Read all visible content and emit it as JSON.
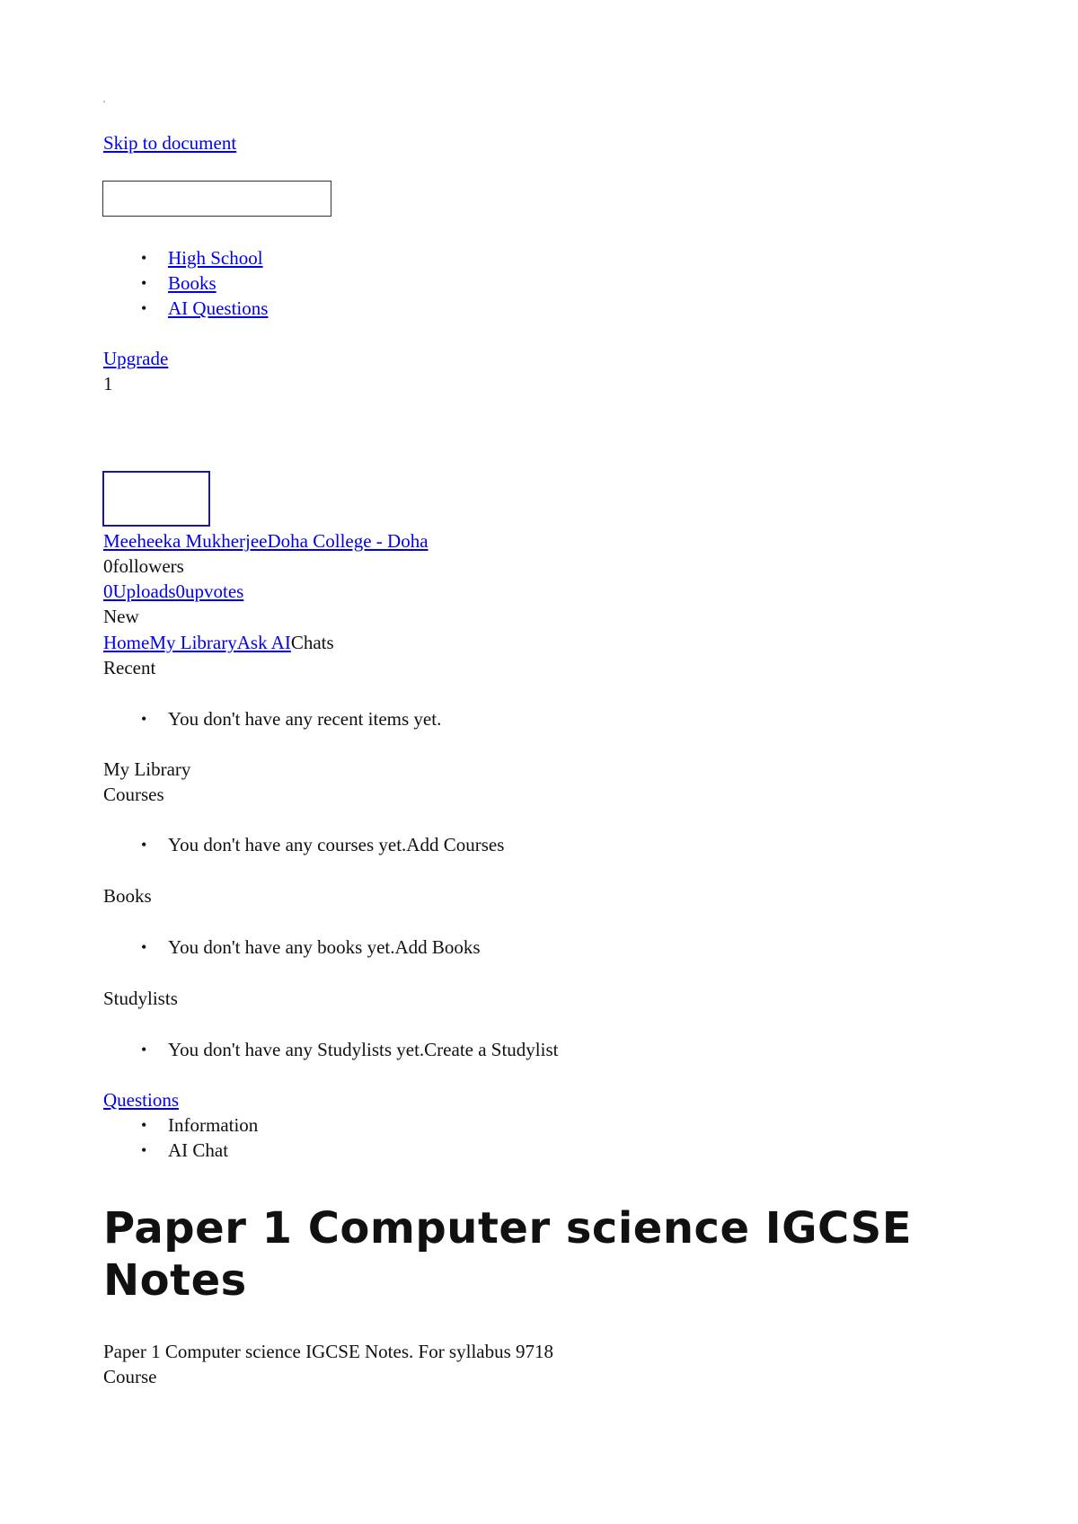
{
  "skip_link": "Skip to document",
  "search": {
    "placeholder": ""
  },
  "nav": {
    "items": [
      "High School",
      "Books",
      "AI Questions"
    ]
  },
  "upgrade": {
    "label": "Upgrade",
    "count": "1"
  },
  "profile": {
    "name_link": "Meeheeka MukherjeeDoha College - Doha",
    "followers": "0followers",
    "stats_link": "0Uploads0upvotes"
  },
  "new_label": "New",
  "menu": {
    "home": "Home",
    "library": "My Library",
    "ask_ai": "Ask AI",
    "chats": "Chats"
  },
  "recent": {
    "heading": "Recent",
    "empty": "You don't have any recent items yet."
  },
  "library": {
    "heading": "My Library",
    "courses_heading": "Courses",
    "courses_empty": "You don't have any courses yet.",
    "courses_action": "Add Courses",
    "books_heading": "Books",
    "books_empty": "You don't have any books yet.",
    "books_action": "Add Books",
    "studylists_heading": "Studylists",
    "studylists_empty": "You don't have any Studylists yet.",
    "studylists_action": "Create a Studylist"
  },
  "questions_link": "Questions",
  "doc_tabs": [
    "Information",
    "AI Chat"
  ],
  "document": {
    "title": "Paper 1 Computer science IGCSE Notes",
    "description": "Paper 1 Computer science IGCSE Notes. For syllabus 9718",
    "course_label": "Course"
  }
}
